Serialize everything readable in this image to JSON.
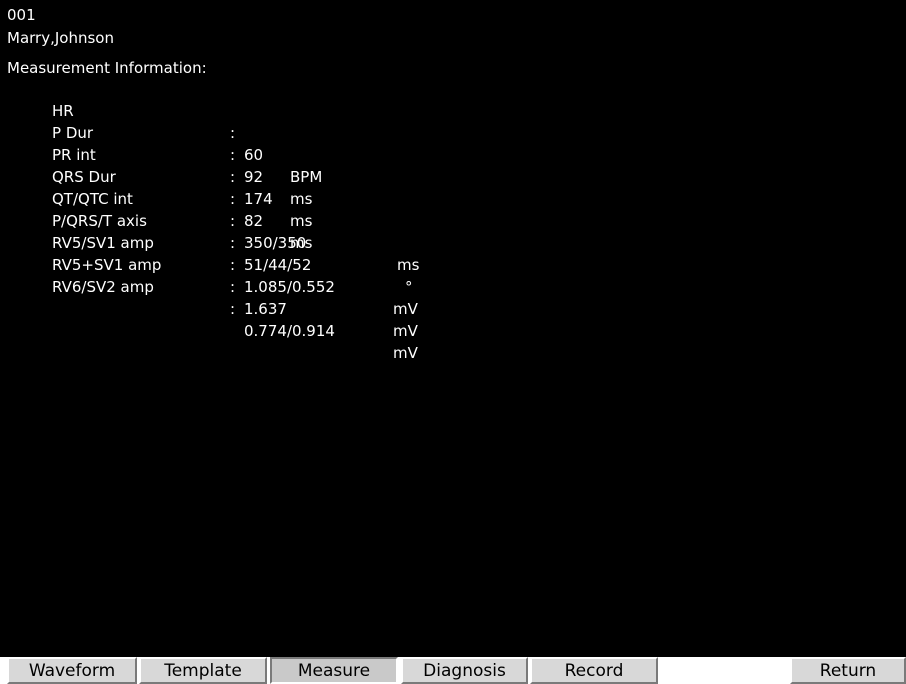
{
  "patient": {
    "id": "001",
    "name": "Marry,Johnson"
  },
  "section_title": "Measurement Information:",
  "measurements": [
    {
      "label": "HR",
      "value": "60",
      "unit": "BPM"
    },
    {
      "label": "P Dur",
      "value": "92",
      "unit": "ms"
    },
    {
      "label": "PR int",
      "value": "174",
      "unit": "ms"
    },
    {
      "label": "QRS Dur",
      "value": "82",
      "unit": "ms"
    },
    {
      "label": "QT/QTC int",
      "value": "350/350",
      "unit": "ms"
    },
    {
      "label": "P/QRS/T axis",
      "value": "51/44/52",
      "unit": "°"
    },
    {
      "label": "RV5/SV1 amp",
      "value": "1.085/0.552",
      "unit": "mV"
    },
    {
      "label": "RV5+SV1 amp",
      "value": "1.637",
      "unit": "mV"
    },
    {
      "label": "RV6/SV2 amp",
      "value": "0.774/0.914",
      "unit": "mV"
    }
  ],
  "separator": ":",
  "tabs": [
    {
      "label": "Waveform",
      "active": false
    },
    {
      "label": "Template",
      "active": false
    },
    {
      "label": "Measure",
      "active": true
    },
    {
      "label": "Diagnosis",
      "active": false
    },
    {
      "label": "Record",
      "active": false
    },
    {
      "label": "Return",
      "active": false
    }
  ]
}
